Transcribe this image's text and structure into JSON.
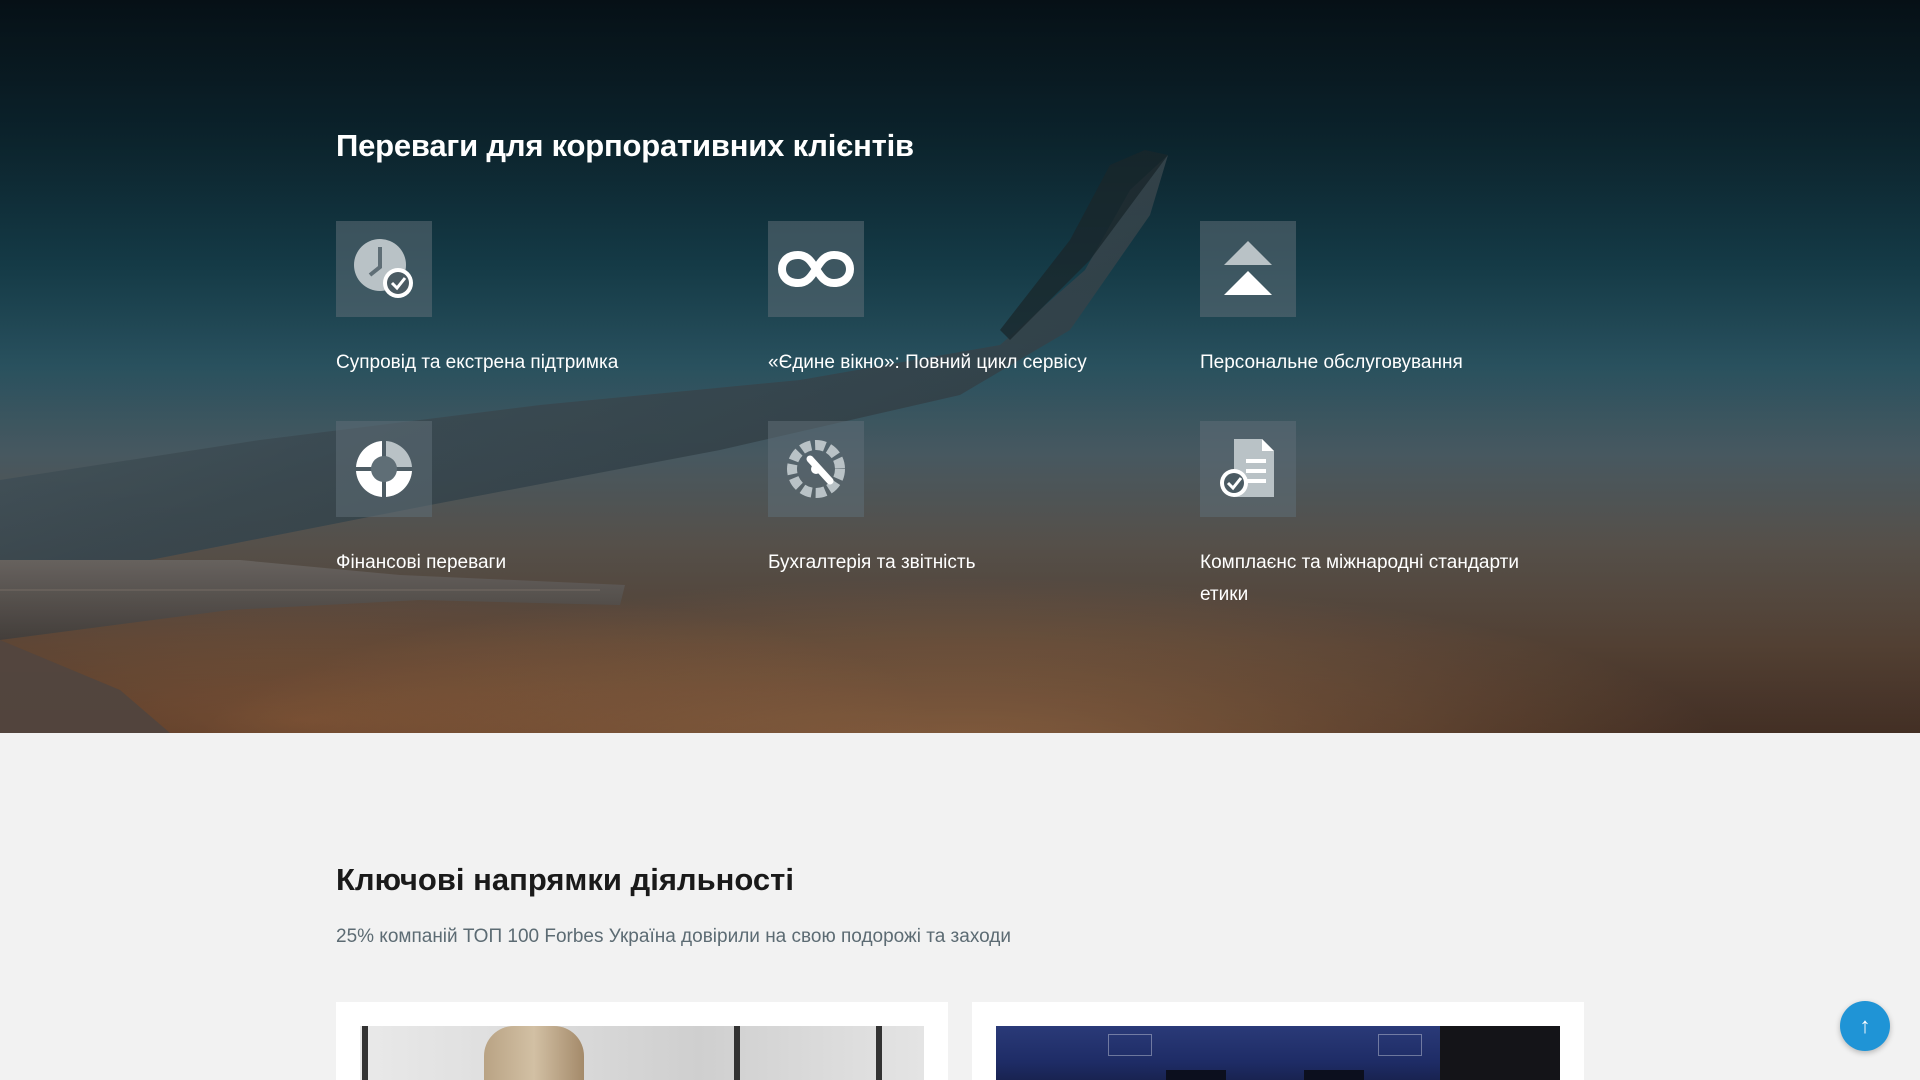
{
  "benefits": {
    "title": "Переваги для корпоративних клієнтів",
    "items": [
      {
        "label": "Супровід та екстрена підтримка",
        "icon": "clock-check-icon"
      },
      {
        "label": "«Єдине вікно»: Повний цикл сервісу",
        "icon": "infinity-icon"
      },
      {
        "label": "Персональне обслуговування",
        "icon": "double-chevron-up-icon"
      },
      {
        "label": "Фінансові переваги",
        "icon": "pie-chart-icon"
      },
      {
        "label": "Бухгалтерія та звітність",
        "icon": "gauge-icon"
      },
      {
        "label": "Комплаєнс та міжнародні стандарти етики",
        "icon": "document-check-icon"
      }
    ]
  },
  "directions": {
    "title": "Ключові напрямки діяльності",
    "subtitle": "25% компаній ТОП 100 Forbes Україна довірили на свою подорожі та заходи"
  },
  "scroll_top": {
    "label": "↑"
  },
  "colors": {
    "accent": "#1f94d6",
    "icon_box": "#5f6e76"
  }
}
